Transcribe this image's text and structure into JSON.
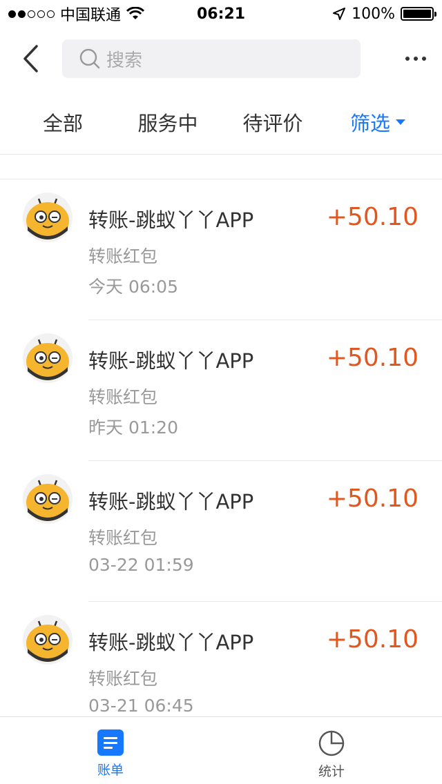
{
  "status_bar": {
    "carrier": "中国联通",
    "time": "06:21",
    "battery": "100%",
    "signal_strength": 2
  },
  "nav": {
    "search_placeholder": "搜索"
  },
  "tabs": [
    {
      "label": "全部"
    },
    {
      "label": "服务中"
    },
    {
      "label": "待评价"
    },
    {
      "label": "筛选"
    }
  ],
  "transactions": [
    {
      "title": "转账-跳蚁丫丫APP",
      "subtitle": "转账红包",
      "time": "今天  06:05",
      "amount": "+50.10"
    },
    {
      "title": "转账-跳蚁丫丫APP",
      "subtitle": "转账红包",
      "time": "昨天  01:20",
      "amount": "+50.10"
    },
    {
      "title": "转账-跳蚁丫丫APP",
      "subtitle": "转账红包",
      "time": "03-22  01:59",
      "amount": "+50.10"
    },
    {
      "title": "转账-跳蚁丫丫APP",
      "subtitle": "转账红包",
      "time": "03-21  06:45",
      "amount": "+50.10"
    }
  ],
  "tab_bar": [
    {
      "label": "账单",
      "icon": "bill-icon",
      "active": true
    },
    {
      "label": "统计",
      "icon": "pie-chart-icon",
      "active": false
    }
  ],
  "colors": {
    "accent": "#1677ff",
    "amount": "#e0581f"
  }
}
